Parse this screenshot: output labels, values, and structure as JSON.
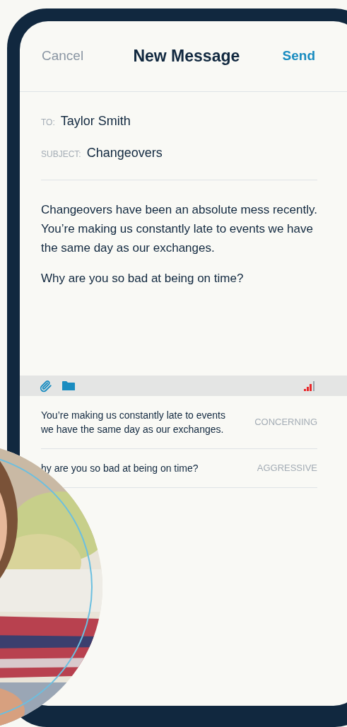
{
  "header": {
    "cancel": "Cancel",
    "title": "New Message",
    "send": "Send"
  },
  "fields": [
    {
      "label": "TO:",
      "value": "Taylor Smith"
    },
    {
      "label": "SUBJECT:",
      "value": "Changeovers"
    }
  ],
  "body": [
    "Changeovers have been an absolute mess recently. You’re making us constantly late to events we have the same day as our exchanges.",
    "Why are you so bad at being on time?"
  ],
  "flags": [
    {
      "text": "You’re making us constantly late to events we have the same day as our exchanges.",
      "tone": "CONCERNING"
    },
    {
      "text": "hy are you so bad at being on time?",
      "tone": "AGGRESSIVE"
    }
  ]
}
